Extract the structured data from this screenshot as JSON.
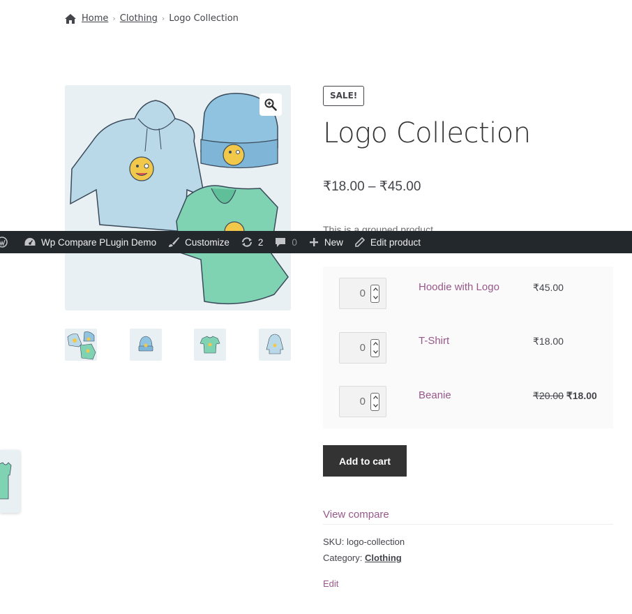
{
  "breadcrumb": {
    "home": "Home",
    "category": "Clothing",
    "current": "Logo Collection",
    "separator": "›"
  },
  "product": {
    "sale_badge": "SALE!",
    "title": "Logo Collection",
    "price_range": "₹18.00 – ₹45.00",
    "short_description": "This is a grouped product."
  },
  "gallery": {
    "zoom_icon": "magnify-plus-icon",
    "thumbnails": [
      "logo-collection-thumb",
      "beanie-thumb",
      "tshirt-thumb",
      "hoodie-thumb"
    ]
  },
  "adminbar": {
    "site_name": "Wp Compare PLugin Demo",
    "customize": "Customize",
    "updates_count": "2",
    "comments_count": "0",
    "new": "New",
    "edit_product": "Edit product"
  },
  "grouped_items": [
    {
      "qty": "0",
      "name": "Hoodie with Logo",
      "price": "₹45.00"
    },
    {
      "qty": "0",
      "name": "T-Shirt",
      "price": "₹18.00"
    },
    {
      "qty": "0",
      "name": "Beanie",
      "regular_price": "₹20.00",
      "sale_price": "₹18.00"
    }
  ],
  "add_to_cart": "Add to cart",
  "view_compare": "View compare",
  "meta": {
    "sku_label": "SKU:",
    "sku": "logo-collection",
    "category_label": "Category:",
    "category": "Clothing"
  },
  "edit_link": "Edit",
  "colors": {
    "accent": "#96588a",
    "admin_bar": "#23282d",
    "button": "#333333",
    "image_bg": "#e9f0f3"
  }
}
